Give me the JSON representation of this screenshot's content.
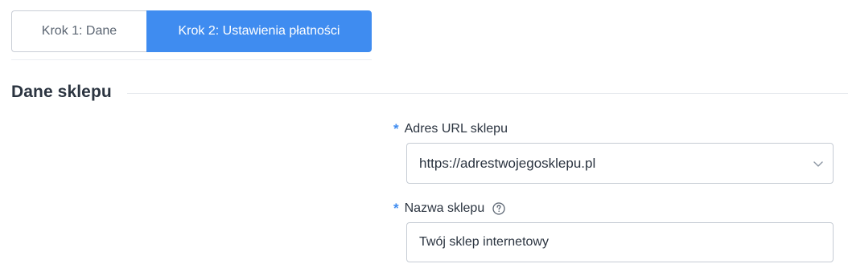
{
  "steps": [
    {
      "label": "Krok 1: Dane",
      "active": false
    },
    {
      "label": "Krok 2: Ustawienia płatności",
      "active": true
    }
  ],
  "section": {
    "title": "Dane sklepu"
  },
  "form": {
    "url": {
      "required_mark": "*",
      "label": "Adres URL sklepu",
      "value": "https://adrestwojegosklepu.pl",
      "icon": "chevron-down-icon"
    },
    "shop_name": {
      "required_mark": "*",
      "label": "Nazwa sklepu",
      "help_icon": "question-circle-icon",
      "value": "Twój sklep internetowy"
    }
  },
  "colors": {
    "accent": "#3f8cf0",
    "border": "#c6ccd4",
    "text": "#2b3440"
  }
}
